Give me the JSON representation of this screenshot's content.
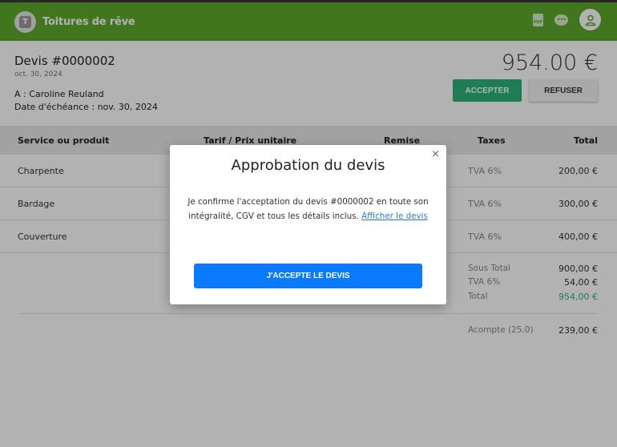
{
  "header": {
    "brand": "Toitures de rêve",
    "logo_letter": "T",
    "pdf_icon_text": "PDF",
    "chat_icon_text": "•••",
    "color": "#5da82b"
  },
  "quote": {
    "title": "Devis #0000002",
    "date": "oct. 30, 2024",
    "recipient": "A : Caroline Reuland",
    "due_date": "Date d'échéance : nov. 30, 2024",
    "amount": "954.00 €",
    "accept_label": "ACCEPTER",
    "refuse_label": "REFUSER",
    "accept_color": "#2db37a"
  },
  "table": {
    "headers": [
      "Service ou produit",
      "Tarif / Prix unitaire",
      "Remise",
      "Taxes",
      "Total"
    ],
    "rows": [
      {
        "name": "Charpente",
        "tax": "TVA 6%",
        "total": "200,00 €"
      },
      {
        "name": "Bardage",
        "tax": "TVA 6%",
        "total": "300,00 €"
      },
      {
        "name": "Couverture",
        "tax": "TVA 6%",
        "total": "400,00 €"
      }
    ]
  },
  "summary": {
    "subtotal_label": "Sous Total",
    "subtotal": "900,00 €",
    "tax_label": "TVA 6%",
    "tax": "54,00 €",
    "total_label": "Total",
    "total": "954,00 €",
    "deposit_label": "Acompte (25.0)",
    "deposit": "239,00 €"
  },
  "modal": {
    "close": "×",
    "title": "Approbation du devis",
    "text": "Je confirme l'acceptation du devis #0000002 en toute son intégralité, CGV et tous les détails inclus.",
    "link": "Afficher le devis",
    "button": "J'ACCEPTE LE DEVIS",
    "button_color": "#0a7bff"
  }
}
